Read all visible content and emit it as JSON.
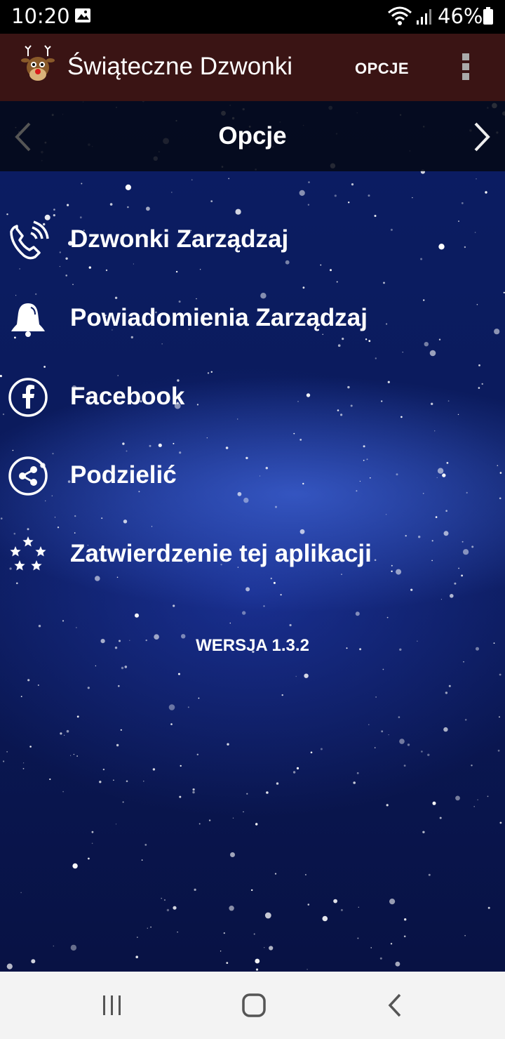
{
  "status_bar": {
    "time": "10:20",
    "battery": "46%"
  },
  "app_bar": {
    "title": "Świąteczne Dzwonki",
    "action": "OPCJE"
  },
  "page": {
    "title": "Opcje"
  },
  "menu": {
    "items": [
      {
        "label": "Dzwonki Zarządzaj",
        "icon": "phone-ringing-icon"
      },
      {
        "label": "Powiadomienia Zarządzaj",
        "icon": "bell-icon"
      },
      {
        "label": "Facebook",
        "icon": "facebook-icon"
      },
      {
        "label": "Podzielić",
        "icon": "share-icon"
      },
      {
        "label": "Zatwierdzenie tej aplikacji",
        "icon": "stars-icon"
      }
    ]
  },
  "version": "WERSJA 1.3.2",
  "colors": {
    "app_bar": "#3a1414",
    "background": "#0b1d63",
    "text": "#ffffff",
    "nav_bar": "#f3f3f3"
  }
}
